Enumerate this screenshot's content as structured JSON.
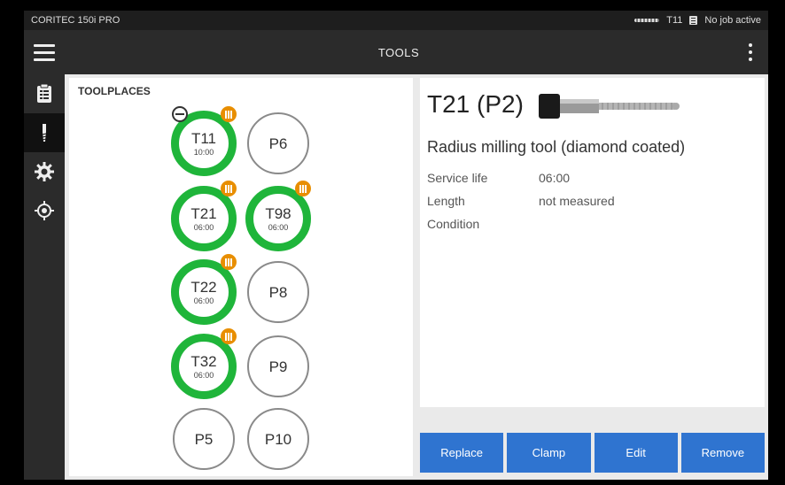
{
  "status": {
    "model": "CORITEC 150i PRO",
    "current_tool": "T11",
    "job_status": "No job active"
  },
  "header": {
    "title": "TOOLS"
  },
  "sidebar": {
    "items": [
      {
        "icon": "clipboard-icon"
      },
      {
        "icon": "tool-icon"
      },
      {
        "icon": "settings-gear-icon"
      },
      {
        "icon": "target-icon"
      }
    ]
  },
  "toolplaces": {
    "heading": "TOOLPLACES",
    "slots": [
      {
        "name": "T11",
        "time": "10:00",
        "loaded": true
      },
      {
        "name": "P6",
        "loaded": false
      },
      {
        "name": "T21",
        "time": "06:00",
        "loaded": true
      },
      {
        "name": "T98",
        "time": "06:00",
        "loaded": true
      },
      {
        "name": "T22",
        "time": "06:00",
        "loaded": true
      },
      {
        "name": "P8",
        "loaded": false
      },
      {
        "name": "T32",
        "time": "06:00",
        "loaded": true
      },
      {
        "name": "P9",
        "loaded": false
      },
      {
        "name": "P5",
        "loaded": false
      },
      {
        "name": "P10",
        "loaded": false
      }
    ]
  },
  "detail": {
    "title": "T21 (P2)",
    "description": "Radius milling tool (diamond coated)",
    "props": [
      {
        "label": "Service life",
        "value": "06:00"
      },
      {
        "label": "Length",
        "value": "not measured"
      },
      {
        "label": "Condition",
        "value": ""
      }
    ]
  },
  "actions": {
    "replace": "Replace",
    "clamp": "Clamp",
    "edit": "Edit",
    "remove": "Remove"
  },
  "colors": {
    "accent_blue": "#2f74d0",
    "loaded_green": "#1fb53a",
    "badge_orange": "#e88e00"
  }
}
